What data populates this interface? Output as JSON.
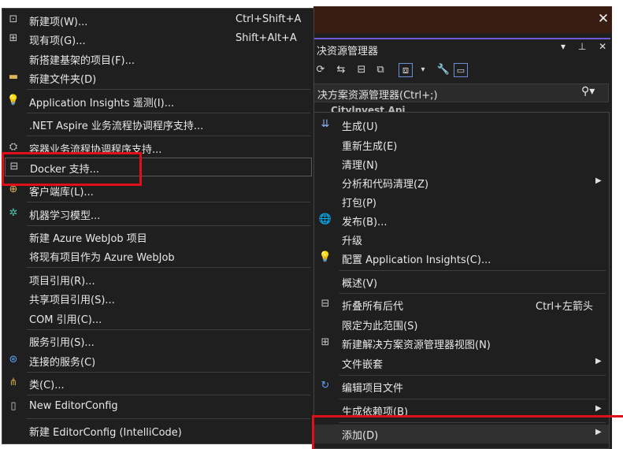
{
  "window": {
    "close_glyph": "✕"
  },
  "solution_explorer": {
    "title": "决资源管理器",
    "header_icons": "▾ ⊥ ✕",
    "search_placeholder": "决方案资源管理器(Ctrl+;)",
    "tree_peek": "Citylnvest.Api"
  },
  "add_submenu": {
    "items": [
      {
        "label": "新建项(W)...",
        "shortcut": "Ctrl+Shift+A",
        "icon": "new-item-icon"
      },
      {
        "label": "现有项(G)...",
        "shortcut": "Shift+Alt+A",
        "icon": "existing-item-icon"
      },
      {
        "label": "新搭建基架的项目(F)...",
        "shortcut": "",
        "icon": ""
      },
      {
        "label": "新建文件夹(D)",
        "shortcut": "",
        "icon": "new-folder-icon"
      },
      {
        "label": "Application Insights 遥测(I)...",
        "shortcut": "",
        "icon": "app-insights-icon"
      },
      {
        "label": ".NET Aspire 业务流程协调程序支持...",
        "shortcut": "",
        "icon": ""
      },
      {
        "label": "容器业务流程协调程序支持...",
        "shortcut": "",
        "icon": "container-icon"
      },
      {
        "label": "Docker 支持...",
        "shortcut": "",
        "icon": "docker-icon"
      },
      {
        "label": "客户端库(L)...",
        "shortcut": "",
        "icon": "client-library-icon"
      },
      {
        "label": "机器学习模型...",
        "shortcut": "",
        "icon": "ml-model-icon"
      },
      {
        "label": "新建 Azure WebJob 项目",
        "shortcut": "",
        "icon": ""
      },
      {
        "label": "将现有项目作为 Azure WebJob",
        "shortcut": "",
        "icon": ""
      },
      {
        "label": "项目引用(R)...",
        "shortcut": "",
        "icon": ""
      },
      {
        "label": "共享项目引用(S)...",
        "shortcut": "",
        "icon": ""
      },
      {
        "label": "COM 引用(C)...",
        "shortcut": "",
        "icon": ""
      },
      {
        "label": "服务引用(S)...",
        "shortcut": "",
        "icon": ""
      },
      {
        "label": "连接的服务(C)",
        "shortcut": "",
        "icon": "connected-service-icon"
      },
      {
        "label": "类(C)...",
        "shortcut": "",
        "icon": "class-icon"
      },
      {
        "label": "New EditorConfig",
        "shortcut": "",
        "icon": "editorconfig-icon"
      },
      {
        "label": "新建 EditorConfig (IntelliCode)",
        "shortcut": "",
        "icon": ""
      }
    ]
  },
  "context_menu": {
    "items": [
      {
        "label": "生成(U)",
        "shortcut": "",
        "icon": "build-icon"
      },
      {
        "label": "重新生成(E)",
        "shortcut": "",
        "icon": ""
      },
      {
        "label": "清理(N)",
        "shortcut": "",
        "icon": ""
      },
      {
        "label": "分析和代码清理(Z)",
        "shortcut": "",
        "icon": "",
        "submenu": true
      },
      {
        "label": "打包(P)",
        "shortcut": "",
        "icon": ""
      },
      {
        "label": "发布(B)...",
        "shortcut": "",
        "icon": "publish-icon"
      },
      {
        "label": "升级",
        "shortcut": "",
        "icon": ""
      },
      {
        "label": "配置 Application Insights(C)...",
        "shortcut": "",
        "icon": "app-insights-icon"
      },
      {
        "label": "概述(V)",
        "shortcut": "",
        "icon": ""
      },
      {
        "label": "折叠所有后代",
        "shortcut": "Ctrl+左箭头",
        "icon": "collapse-icon"
      },
      {
        "label": "限定为此范围(S)",
        "shortcut": "",
        "icon": ""
      },
      {
        "label": "新建解决方案资源管理器视图(N)",
        "shortcut": "",
        "icon": "new-view-icon"
      },
      {
        "label": "文件嵌套",
        "shortcut": "",
        "icon": "",
        "submenu": true
      },
      {
        "label": "编辑项目文件",
        "shortcut": "",
        "icon": "edit-project-icon"
      },
      {
        "label": "生成依赖项(B)",
        "shortcut": "",
        "icon": "",
        "submenu": true
      },
      {
        "label": "添加(D)",
        "shortcut": "",
        "icon": "",
        "submenu": true
      }
    ]
  },
  "colors": {
    "menu_bg": "#1f1f1f",
    "highlight_red": "#e0101b",
    "accent": "#6b5bd6"
  }
}
